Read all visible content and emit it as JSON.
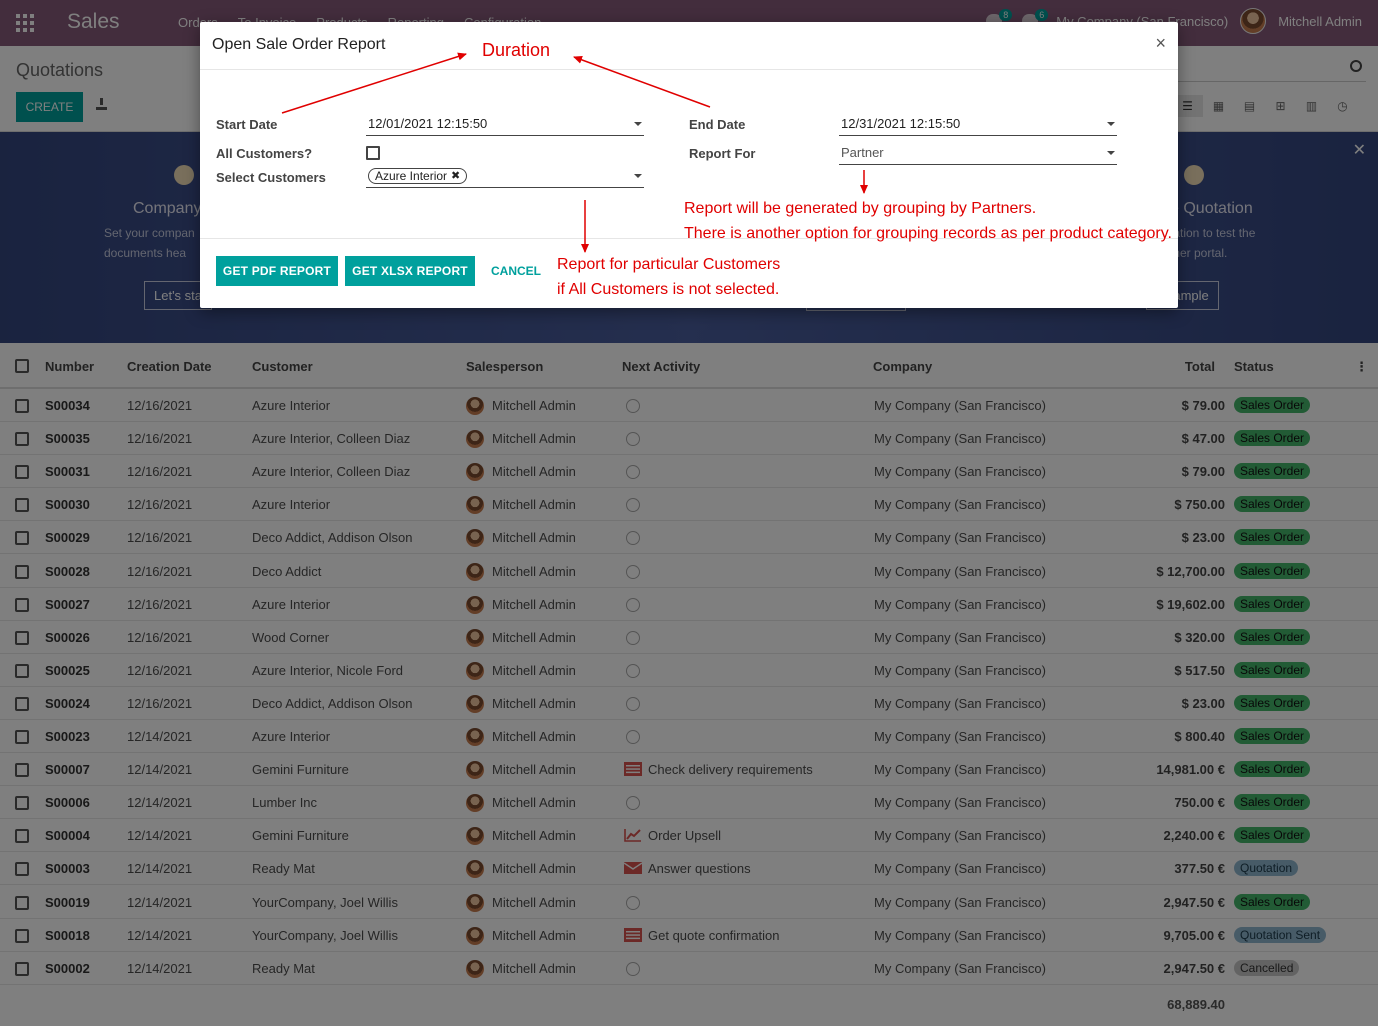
{
  "navbar": {
    "app_name": "Sales",
    "menu": [
      "Orders",
      "To Invoice",
      "Products",
      "Reporting",
      "Configuration"
    ],
    "activity_count": "8",
    "message_count": "6",
    "company": "My Company (San Francisco)",
    "user": "Mitchell Admin"
  },
  "control_panel": {
    "title": "Quotations",
    "create_label": "CREATE"
  },
  "banner": {
    "left_title": "Company",
    "left_text_1": "Set your compan",
    "left_text_2": "documents hea",
    "left_button": "Let's sta",
    "right_title": "e Quotation",
    "right_text_1": "tation to test the",
    "right_text_2": "mer portal.",
    "right_button": "d sample"
  },
  "list": {
    "columns": [
      "Number",
      "Creation Date",
      "Customer",
      "Salesperson",
      "Next Activity",
      "Company",
      "Total",
      "Status"
    ],
    "rows": [
      {
        "number": "S00034",
        "date": "12/16/2021",
        "customer": "Azure Interior",
        "salesperson": "Mitchell Admin",
        "activity": "",
        "activity_icon": "clock",
        "company": "My Company (San Francisco)",
        "total": "$ 79.00",
        "status": "Sales Order",
        "status_type": "so"
      },
      {
        "number": "S00035",
        "date": "12/16/2021",
        "customer": "Azure Interior, Colleen Diaz",
        "salesperson": "Mitchell Admin",
        "activity": "",
        "activity_icon": "clock",
        "company": "My Company (San Francisco)",
        "total": "$ 47.00",
        "status": "Sales Order",
        "status_type": "so"
      },
      {
        "number": "S00031",
        "date": "12/16/2021",
        "customer": "Azure Interior, Colleen Diaz",
        "salesperson": "Mitchell Admin",
        "activity": "",
        "activity_icon": "clock",
        "company": "My Company (San Francisco)",
        "total": "$ 79.00",
        "status": "Sales Order",
        "status_type": "so"
      },
      {
        "number": "S00030",
        "date": "12/16/2021",
        "customer": "Azure Interior",
        "salesperson": "Mitchell Admin",
        "activity": "",
        "activity_icon": "clock",
        "company": "My Company (San Francisco)",
        "total": "$ 750.00",
        "status": "Sales Order",
        "status_type": "so"
      },
      {
        "number": "S00029",
        "date": "12/16/2021",
        "customer": "Deco Addict, Addison Olson",
        "salesperson": "Mitchell Admin",
        "activity": "",
        "activity_icon": "clock",
        "company": "My Company (San Francisco)",
        "total": "$ 23.00",
        "status": "Sales Order",
        "status_type": "so"
      },
      {
        "number": "S00028",
        "date": "12/16/2021",
        "customer": "Deco Addict",
        "salesperson": "Mitchell Admin",
        "activity": "",
        "activity_icon": "clock",
        "company": "My Company (San Francisco)",
        "total": "$ 12,700.00",
        "status": "Sales Order",
        "status_type": "so"
      },
      {
        "number": "S00027",
        "date": "12/16/2021",
        "customer": "Azure Interior",
        "salesperson": "Mitchell Admin",
        "activity": "",
        "activity_icon": "clock",
        "company": "My Company (San Francisco)",
        "total": "$ 19,602.00",
        "status": "Sales Order",
        "status_type": "so"
      },
      {
        "number": "S00026",
        "date": "12/16/2021",
        "customer": "Wood Corner",
        "salesperson": "Mitchell Admin",
        "activity": "",
        "activity_icon": "clock",
        "company": "My Company (San Francisco)",
        "total": "$ 320.00",
        "status": "Sales Order",
        "status_type": "so"
      },
      {
        "number": "S00025",
        "date": "12/16/2021",
        "customer": "Azure Interior, Nicole Ford",
        "salesperson": "Mitchell Admin",
        "activity": "",
        "activity_icon": "clock",
        "company": "My Company (San Francisco)",
        "total": "$ 517.50",
        "status": "Sales Order",
        "status_type": "so"
      },
      {
        "number": "S00024",
        "date": "12/16/2021",
        "customer": "Deco Addict, Addison Olson",
        "salesperson": "Mitchell Admin",
        "activity": "",
        "activity_icon": "clock",
        "company": "My Company (San Francisco)",
        "total": "$ 23.00",
        "status": "Sales Order",
        "status_type": "so"
      },
      {
        "number": "S00023",
        "date": "12/14/2021",
        "customer": "Azure Interior",
        "salesperson": "Mitchell Admin",
        "activity": "",
        "activity_icon": "clock",
        "company": "My Company (San Francisco)",
        "total": "$ 800.40",
        "status": "Sales Order",
        "status_type": "so"
      },
      {
        "number": "S00007",
        "date": "12/14/2021",
        "customer": "Gemini Furniture",
        "salesperson": "Mitchell Admin",
        "activity": "Check delivery requirements",
        "activity_icon": "tasks",
        "company": "My Company (San Francisco)",
        "total": "14,981.00 €",
        "status": "Sales Order",
        "status_type": "so"
      },
      {
        "number": "S00006",
        "date": "12/14/2021",
        "customer": "Lumber Inc",
        "salesperson": "Mitchell Admin",
        "activity": "",
        "activity_icon": "clock",
        "company": "My Company (San Francisco)",
        "total": "750.00 €",
        "status": "Sales Order",
        "status_type": "so"
      },
      {
        "number": "S00004",
        "date": "12/14/2021",
        "customer": "Gemini Furniture",
        "salesperson": "Mitchell Admin",
        "activity": "Order Upsell",
        "activity_icon": "chart",
        "company": "My Company (San Francisco)",
        "total": "2,240.00 €",
        "status": "Sales Order",
        "status_type": "so"
      },
      {
        "number": "S00003",
        "date": "12/14/2021",
        "customer": "Ready Mat",
        "salesperson": "Mitchell Admin",
        "activity": "Answer questions",
        "activity_icon": "mail",
        "company": "My Company (San Francisco)",
        "total": "377.50 €",
        "status": "Quotation",
        "status_type": "q"
      },
      {
        "number": "S00019",
        "date": "12/14/2021",
        "customer": "YourCompany, Joel Willis",
        "salesperson": "Mitchell Admin",
        "activity": "",
        "activity_icon": "clock",
        "company": "My Company (San Francisco)",
        "total": "2,947.50 €",
        "status": "Sales Order",
        "status_type": "so"
      },
      {
        "number": "S00018",
        "date": "12/14/2021",
        "customer": "YourCompany, Joel Willis",
        "salesperson": "Mitchell Admin",
        "activity": "Get quote confirmation",
        "activity_icon": "tasks",
        "company": "My Company (San Francisco)",
        "total": "9,705.00 €",
        "status": "Quotation Sent",
        "status_type": "qs"
      },
      {
        "number": "S00002",
        "date": "12/14/2021",
        "customer": "Ready Mat",
        "salesperson": "Mitchell Admin",
        "activity": "",
        "activity_icon": "clock",
        "company": "My Company (San Francisco)",
        "total": "2,947.50 €",
        "status": "Cancelled",
        "status_type": "c"
      }
    ],
    "grand_total": "68,889.40"
  },
  "modal": {
    "title": "Open Sale Order Report",
    "close": "×",
    "start_date_label": "Start Date",
    "start_date_value": "12/01/2021 12:15:50",
    "end_date_label": "End Date",
    "end_date_value": "12/31/2021 12:15:50",
    "all_customers_label": "All Customers?",
    "all_customers_checked": false,
    "report_for_label": "Report For",
    "report_for_value": "Partner",
    "select_customers_label": "Select Customers",
    "selected_customer_tag": "Azure Interior",
    "pdf_button": "GET PDF REPORT",
    "xlsx_button": "GET XLSX REPORT",
    "cancel_button": "CANCEL"
  },
  "annotations": {
    "duration": "Duration",
    "grouping_1": "Report will be generated by grouping by Partners.",
    "grouping_2": "There is another option for grouping records as per product category.",
    "customers_1": "Report for particular Customers",
    "customers_2": "if All Customers is not selected."
  },
  "colors": {
    "navbar": "#875a7b",
    "primary": "#00a09d",
    "annotation": "#e00000"
  }
}
